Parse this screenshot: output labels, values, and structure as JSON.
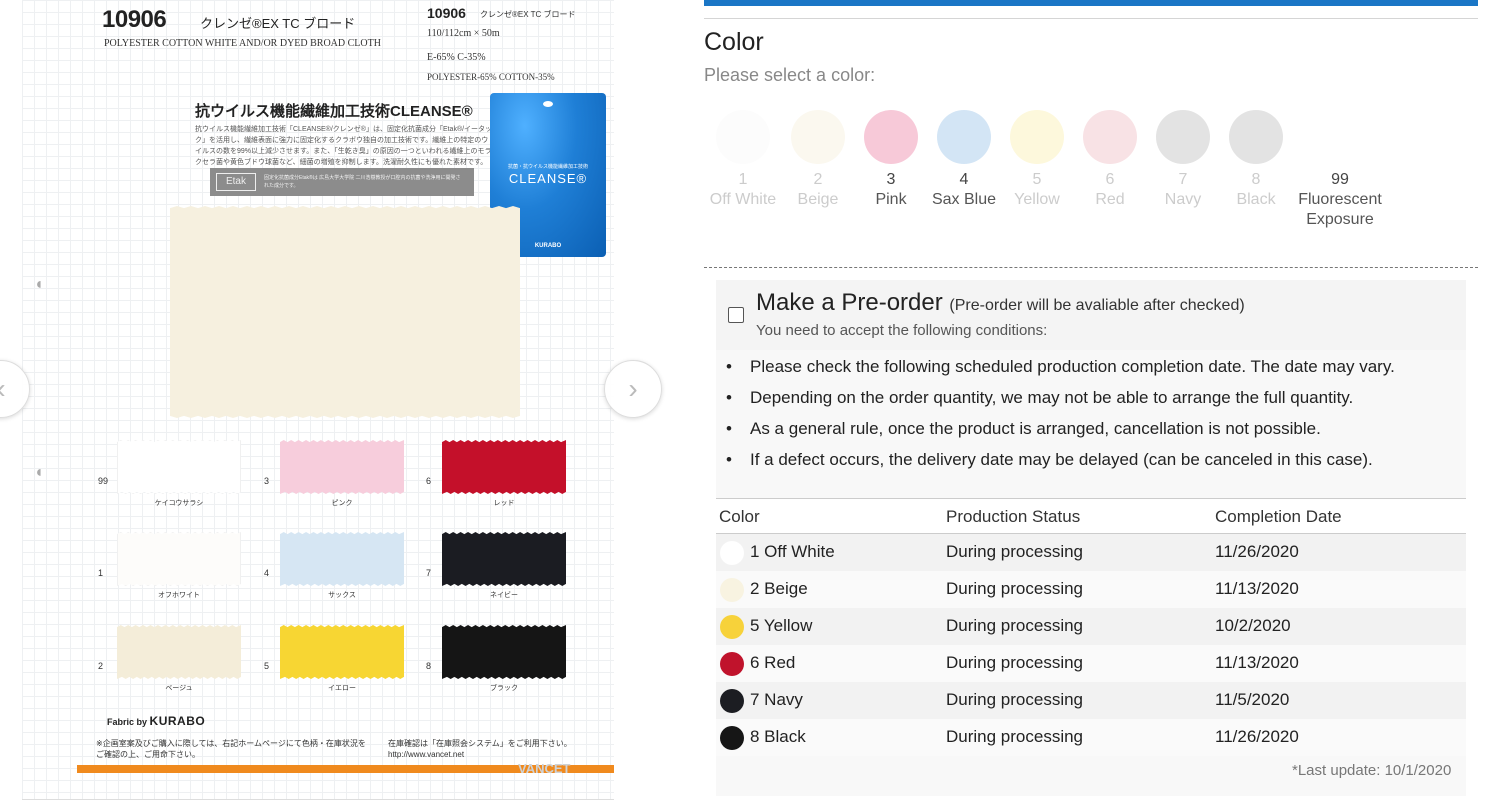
{
  "card": {
    "code": "10906",
    "code_name": "クレンゼ®EX TC ブロード",
    "subtitle": "POLYESTER COTTON WHITE AND/OR DYED BROAD CLOTH",
    "spec_code": "10906",
    "spec_code_name": "クレンゼ®EX TC ブロード",
    "spec_width": "110/112cm × 50m",
    "spec_mix": "E-65% C-35%",
    "spec_fiber": "POLYESTER-65% COTTON-35%",
    "promo_title": "抗ウイルス機能繊維加工技術CLEANSE®",
    "promo_text": "抗ウイルス機能繊維加工技術「CLEANSE®/クレンゼ®」は、固定化抗菌成分「Etak®/イータック」を活用し、繊維表面に強力に固定化するクラボウ独自の加工技術です。繊維上の特定のウイルスの数を99%以上減少させます。また、「生乾き臭」の原因の一つといわれる繊維上のモラクセラ菌や黄色ブドウ球菌など、細菌の増殖を抑制します。洗濯耐久性にも優れた素材です。",
    "etak_logo": "Etak",
    "etak_text": "固定化抗菌成分Etak®は 広島大学大学院 二川浩樹教授が口腔内の抗菌や洗浄用に開発された成分です。",
    "tag_small": "抗菌・抗ウイルス機能繊維加工技術",
    "tag_brand": "CLEANSE®",
    "tag_maker": "KURABO",
    "swatches": [
      {
        "num": "99",
        "name": "ケイコウサラシ",
        "color": "#ffffff"
      },
      {
        "num": "1",
        "name": "オフホワイト",
        "color": "#fdfcfa"
      },
      {
        "num": "2",
        "name": "ベージュ",
        "color": "#f4edd9"
      },
      {
        "num": "3",
        "name": "ピンク",
        "color": "#f7cddc"
      },
      {
        "num": "4",
        "name": "サックス",
        "color": "#d6e6f3"
      },
      {
        "num": "5",
        "name": "イエロー",
        "color": "#f7d633"
      },
      {
        "num": "6",
        "name": "レッド",
        "color": "#c4102a"
      },
      {
        "num": "7",
        "name": "ネイビー",
        "color": "#1b1c22"
      },
      {
        "num": "8",
        "name": "ブラック",
        "color": "#151515"
      }
    ],
    "fabric_by": "Fabric by",
    "fabric_brand": "KURABO",
    "note_left": "※企画室案及びご購入に際しては、右記ホームページにて色柄・在庫状況をご確認の上、ご用命下さい。",
    "note_right": "在庫確認は「在庫照会システム」をご利用下さい。http://www.vancet.net",
    "vancet": "VANCET"
  },
  "colors": {
    "title": "Color",
    "hint": "Please select a color:",
    "options": [
      {
        "num": "1",
        "name": "Off White",
        "color": "#fcfcfc",
        "available": false
      },
      {
        "num": "2",
        "name": "Beige",
        "color": "#fbf8ef",
        "available": false
      },
      {
        "num": "3",
        "name": "Pink",
        "color": "#f7c9d8",
        "available": true
      },
      {
        "num": "4",
        "name": "Sax Blue",
        "color": "#d3e5f5",
        "available": true
      },
      {
        "num": "5",
        "name": "Yellow",
        "color": "#fdf8dc",
        "available": false
      },
      {
        "num": "6",
        "name": "Red",
        "color": "#f8e2e5",
        "available": false
      },
      {
        "num": "7",
        "name": "Navy",
        "color": "#e3e3e3",
        "available": false
      },
      {
        "num": "8",
        "name": "Black",
        "color": "#e3e3e3",
        "available": false
      },
      {
        "num": "99",
        "name": "Fluorescent Exposure",
        "color": "",
        "available": true
      }
    ]
  },
  "preorder": {
    "title": "Make a Pre-order",
    "title_note": "(Pre-order will be avaliable after checked)",
    "subtitle": "You need to accept the following conditions:",
    "conditions": [
      "Please check the following scheduled production completion date. The date may vary.",
      "Depending on the order quantity, we may not be able to arrange the full quantity.",
      "As a general rule, once the product is arranged, cancellation is not possible.",
      "If a defect occurs, the delivery date may be delayed (can be canceled in this case)."
    ],
    "table": {
      "headers": [
        "Color",
        "Production Status",
        "Completion Date"
      ],
      "rows": [
        {
          "color": "1 Off White",
          "dot": "#ffffff",
          "status": "During processing",
          "date": "11/26/2020"
        },
        {
          "color": "2 Beige",
          "dot": "#f8f3e1",
          "status": "During processing",
          "date": "11/13/2020"
        },
        {
          "color": "5 Yellow",
          "dot": "#f7d23a",
          "status": "During processing",
          "date": "10/2/2020"
        },
        {
          "color": "6 Red",
          "dot": "#c0132c",
          "status": "During processing",
          "date": "11/13/2020"
        },
        {
          "color": "7 Navy",
          "dot": "#1c1d22",
          "status": "During processing",
          "date": "11/5/2020"
        },
        {
          "color": "8 Black",
          "dot": "#161616",
          "status": "During processing",
          "date": "11/26/2020"
        }
      ]
    },
    "last_update": "*Last update: 10/1/2020"
  }
}
